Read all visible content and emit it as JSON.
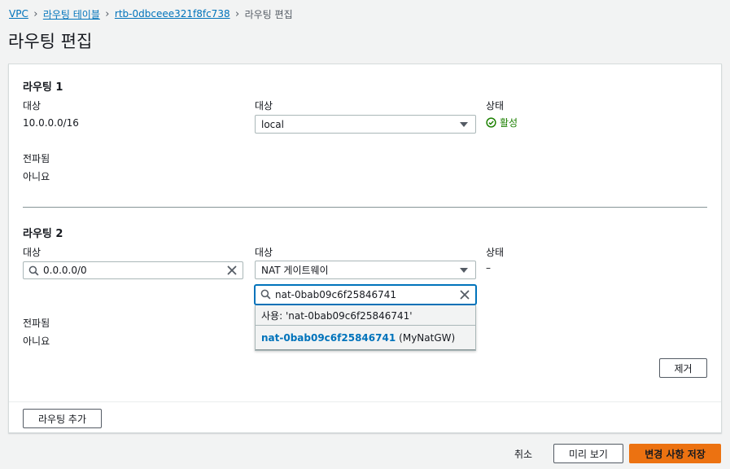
{
  "breadcrumb": {
    "items": [
      "VPC",
      "라우팅 테이블",
      "rtb-0dbceee321f8fc738"
    ],
    "current": "라우팅 편집"
  },
  "page_title": "라우팅 편집",
  "route1": {
    "title": "라우팅 1",
    "dest_label": "대상",
    "dest_value": "10.0.0.0/16",
    "target_label": "대상",
    "target_value": "local",
    "status_label": "상태",
    "status_value": "활성",
    "propagated_label": "전파됨",
    "propagated_value": "아니요"
  },
  "route2": {
    "title": "라우팅 2",
    "dest_label": "대상",
    "dest_value": "0.0.0.0/0",
    "target_label": "대상",
    "target_value": "NAT 게이트웨이",
    "status_label": "상태",
    "status_value": "–",
    "propagated_label": "전파됨",
    "propagated_value": "아니요",
    "target_search_value": "nat-0bab09c6f25846741",
    "dropdown": {
      "use_option": "사용: 'nat-0bab09c6f25846741'",
      "nat_id": "nat-0bab09c6f25846741",
      "nat_name": "(MyNatGW)"
    },
    "remove_label": "제거"
  },
  "add_route_label": "라우팅 추가",
  "footer": {
    "cancel_label": "취소",
    "preview_label": "미리 보기",
    "save_label": "변경 사항 저장"
  },
  "colors": {
    "link": "#0073bb",
    "success": "#1d8102",
    "primary": "#ec7211"
  }
}
